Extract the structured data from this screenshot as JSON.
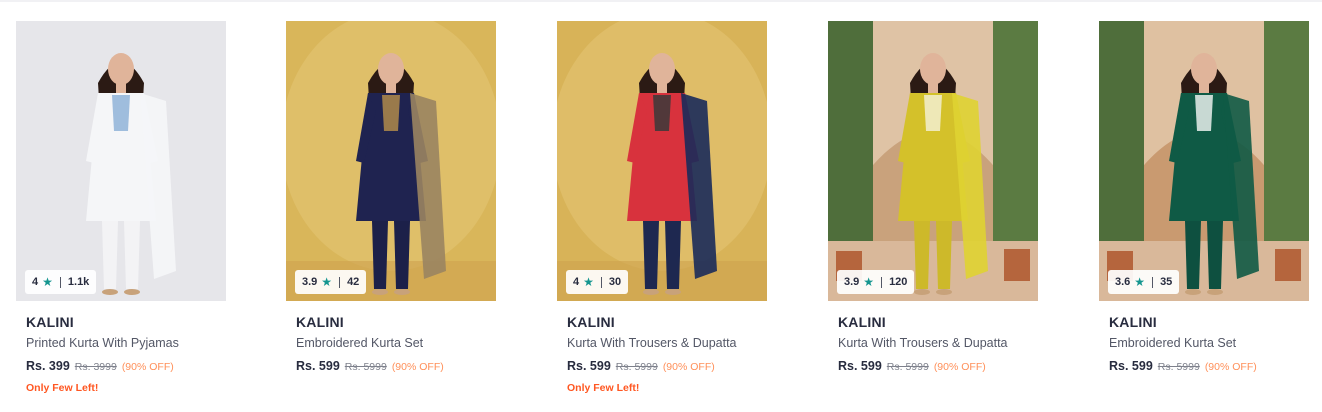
{
  "products": [
    {
      "rating": "4",
      "count": "1.1k",
      "brand": "KALINI",
      "title": "Printed Kurta With Pyjamas",
      "price": "Rs. 399",
      "mrp": "Rs. 3999",
      "discount": "(90% OFF)",
      "note": "Only Few Left!",
      "colors": {
        "bg": "#e6e6ea",
        "kurta": "#f5f6f8",
        "accent": "#8fb3d8",
        "bottom": "#f3f3f5",
        "dupatta": "#f5f6f8"
      }
    },
    {
      "rating": "3.9",
      "count": "42",
      "brand": "KALINI",
      "title": "Embroidered Kurta Set",
      "price": "Rs. 599",
      "mrp": "Rs. 5999",
      "discount": "(90% OFF)",
      "note": "",
      "colors": {
        "bg": "#d9b65a",
        "kurta": "#1f2350",
        "accent": "#b08a4a",
        "bottom": "#1c2049",
        "dupatta": "#9a8460"
      }
    },
    {
      "rating": "4",
      "count": "30",
      "brand": "KALINI",
      "title": "Kurta With Trousers & Dupatta",
      "price": "Rs. 599",
      "mrp": "Rs. 5999",
      "discount": "(90% OFF)",
      "note": "Only Few Left!",
      "colors": {
        "bg": "#d8b358",
        "kurta": "#d8323d",
        "accent": "#3a3a3a",
        "bottom": "#1e2850",
        "dupatta": "#1a2a5a"
      }
    },
    {
      "rating": "3.9",
      "count": "120",
      "brand": "KALINI",
      "title": "Kurta With Trousers & Dupatta",
      "price": "Rs. 599",
      "mrp": "Rs. 5999",
      "discount": "(90% OFF)",
      "note": "",
      "colors": {
        "bg": "#c9a27c",
        "kurta": "#d4c12a",
        "accent": "#f2efd0",
        "bottom": "#cdb92a",
        "dupatta": "#dfd332"
      }
    },
    {
      "rating": "3.6",
      "count": "35",
      "brand": "KALINI",
      "title": "Embroidered Kurta Set",
      "price": "Rs. 599",
      "mrp": "Rs. 5999",
      "discount": "(90% OFF)",
      "note": "",
      "colors": {
        "bg": "#c99a70",
        "kurta": "#0f5a45",
        "accent": "#e9f0ec",
        "bottom": "#0e5040",
        "dupatta": "#0f5a45"
      }
    }
  ]
}
